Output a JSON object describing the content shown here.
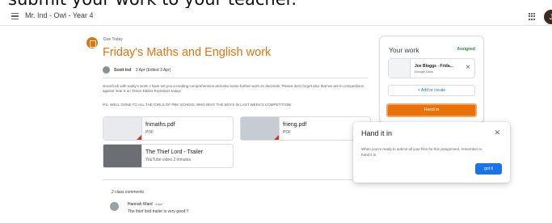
{
  "caption": "submit your work to your teacher.",
  "header": {
    "class_title": "Mr. Ind - Owl - Year 4",
    "user_initial": "J"
  },
  "assignment": {
    "due": "Due Today",
    "title": "Friday's Maths and English work",
    "author": "Scott Ind",
    "date": "3 Apr (Edited 3 Apr)",
    "body": "Good luck with today's work. I have set you a reading comprehension and also some further work on decimals. Please don't forget also that we are in competitions against Year 6 on Times Tables Rockstars today!",
    "shout": "P.S. WELL DONE TO ALL THE GIRLS OF PBK SCHOOL WHO BEAT THE BOYS IN LAST WEEK'S COMPETITION!"
  },
  "attachments": [
    {
      "name": "frimaths.pdf",
      "type": "PDF"
    },
    {
      "name": "frieng.pdf",
      "type": "PDF"
    },
    {
      "name": "The Thief Lord - Trailer",
      "type": "YouTube video  2 minutes"
    }
  ],
  "comments": {
    "label": "2 class comments",
    "author": "Hannah Ward",
    "date": "3 Apr",
    "text": "The thief lord trailer is very good !!"
  },
  "your_work": {
    "title": "Your work",
    "status": "Assigned",
    "file_name": "Joe Bloggs - Frida...",
    "file_type": "Google Docs",
    "add_label": "+ Add or create",
    "hand_in_label": "Hand in"
  },
  "dialog": {
    "title": "Hand it in",
    "body": "When you're ready to submit all your files for this assignment, remember to hand it in.",
    "button": "got it"
  },
  "colors": {
    "accent": "#e8710a",
    "primary_blue": "#1a73e8",
    "assigned_green": "#1e8e3e"
  }
}
